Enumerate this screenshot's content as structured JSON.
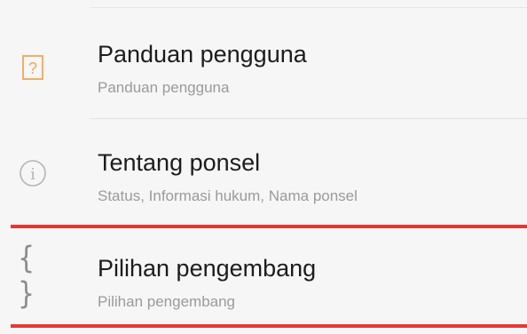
{
  "settings_list": {
    "items": [
      {
        "title": "Panduan pengguna",
        "subtitle": "Panduan pengguna",
        "icon": "help-question-icon",
        "icon_color": "#f2a654"
      },
      {
        "title": "Tentang ponsel",
        "subtitle": "Status, Informasi hukum, Nama ponsel",
        "icon": "info-icon",
        "icon_color": "#b5b5b5"
      },
      {
        "title": "Pilihan pengembang",
        "subtitle": "Pilihan pengembang",
        "icon": "developer-braces-icon",
        "icon_color": "#8c8c8c",
        "highlighted": true
      }
    ],
    "icon_glyphs": {
      "help": "?",
      "info": "i",
      "braces": "{ }"
    }
  },
  "colors": {
    "background": "#f6f6f6",
    "highlight": "#e53935"
  }
}
